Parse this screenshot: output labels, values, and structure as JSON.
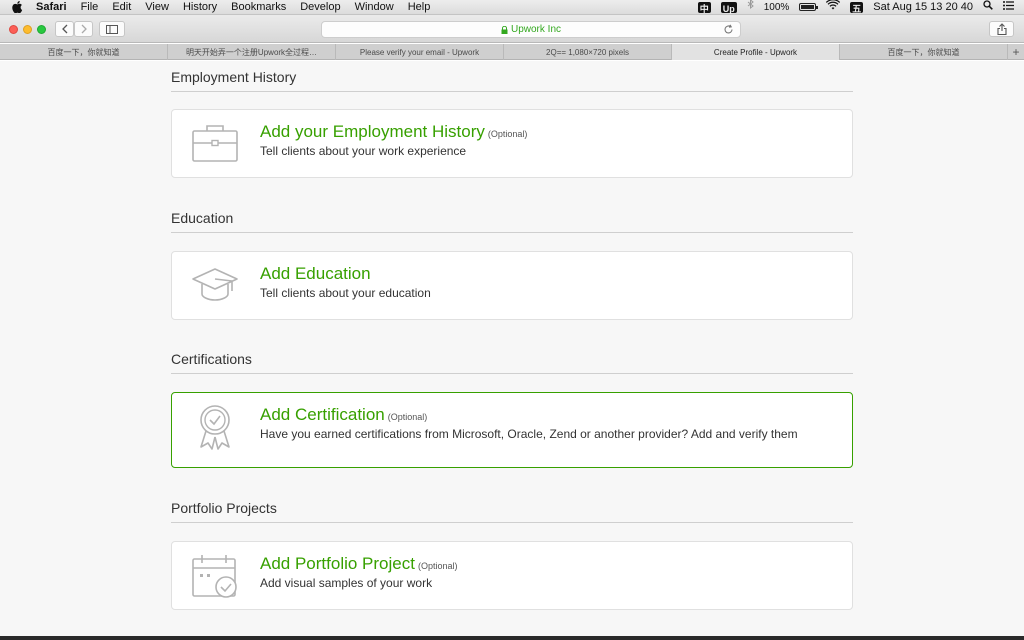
{
  "menubar": {
    "app": "Safari",
    "items": [
      "File",
      "Edit",
      "View",
      "History",
      "Bookmarks",
      "Develop",
      "Window",
      "Help"
    ],
    "status": {
      "input_glyph": "中",
      "upwork_glyph": "Up",
      "battery": "100%",
      "battery_level": 1.0,
      "datetime": "Sat Aug 15  13 20 40"
    }
  },
  "toolbar": {
    "url": "Upwork Inc"
  },
  "tabs": [
    {
      "label": "百度一下，你就知道",
      "active": false
    },
    {
      "label": "明天开始弄一个注册Upwork全过程…",
      "active": false
    },
    {
      "label": "Please verify your email - Upwork",
      "active": false
    },
    {
      "label": "2Q== 1,080×720 pixels",
      "active": false
    },
    {
      "label": "Create Profile - Upwork",
      "active": true
    },
    {
      "label": "百度一下，你就知道",
      "active": false
    }
  ],
  "sections": {
    "employment": {
      "title": "Employment History",
      "card_title": "Add your Employment History",
      "optional": "(Optional)",
      "desc": "Tell clients about your work experience",
      "icon": "briefcase-icon"
    },
    "education": {
      "title": "Education",
      "card_title": "Add Education",
      "desc": "Tell clients about your education",
      "icon": "graduation-cap-icon"
    },
    "certifications": {
      "title": "Certifications",
      "card_title": "Add Certification",
      "optional": "(Optional)",
      "desc": "Have you earned certifications from Microsoft, Oracle, Zend or another provider? Add and verify them",
      "icon": "award-ribbon-icon"
    },
    "portfolio": {
      "title": "Portfolio Projects",
      "card_title": "Add Portfolio Project",
      "optional": "(Optional)",
      "desc": "Add visual samples of your work",
      "icon": "calendar-check-icon"
    }
  },
  "colors": {
    "accent": "#37a000",
    "url_green": "#33a81f"
  }
}
